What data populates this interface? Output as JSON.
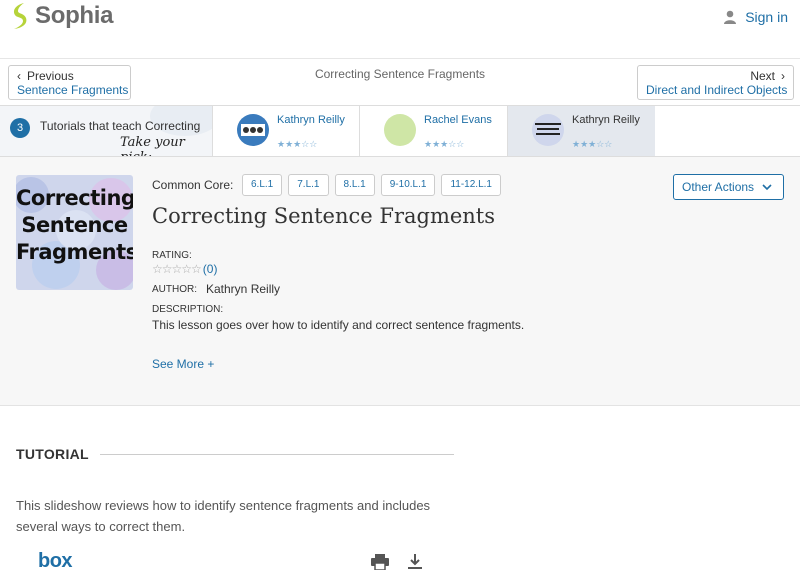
{
  "header": {
    "logo_text": "Sophia",
    "signin_label": "Sign in",
    "brand_color": "#1f6fa6",
    "logo_color": "#b6d33a"
  },
  "nav": {
    "prev_small": "Previous",
    "prev_link": "Sentence Fragments",
    "center_title": "Correcting Sentence Fragments",
    "next_small": "Next",
    "next_link": "Direct and Indirect Objects"
  },
  "tutorials_strip": {
    "count": "3",
    "text": "Tutorials that teach Correcting Sentence Fragments",
    "pick": "Take your pick:",
    "items": [
      {
        "author": "Kathryn Reilly",
        "stars": "★★★☆☆"
      },
      {
        "author": "Rachel Evans",
        "stars": "★★★☆☆"
      },
      {
        "author": "Kathryn Reilly",
        "stars": "★★★☆☆"
      }
    ]
  },
  "lesson": {
    "cover_text": "Correcting Sentence Fragments",
    "common_core_label": "Common Core:",
    "common_core_tags": [
      "6.L.1",
      "7.L.1",
      "8.L.1",
      "9-10.L.1",
      "11-12.L.1"
    ],
    "other_actions_label": "Other Actions",
    "title": "Correcting Sentence Fragments",
    "rating_label": "RATING:",
    "rating_stars": "☆☆☆☆☆",
    "rating_count": "(0)",
    "author_label": "AUTHOR:",
    "author_value": "Kathryn Reilly",
    "description_label": "DESCRIPTION:",
    "description": "This lesson goes over how to identify and correct sentence fragments.",
    "see_more": "See More +"
  },
  "tutorial": {
    "heading": "TUTORIAL",
    "description": "This slideshow reviews how to identify sentence fragments and includes several ways to correct them.",
    "box_logo": "box"
  }
}
